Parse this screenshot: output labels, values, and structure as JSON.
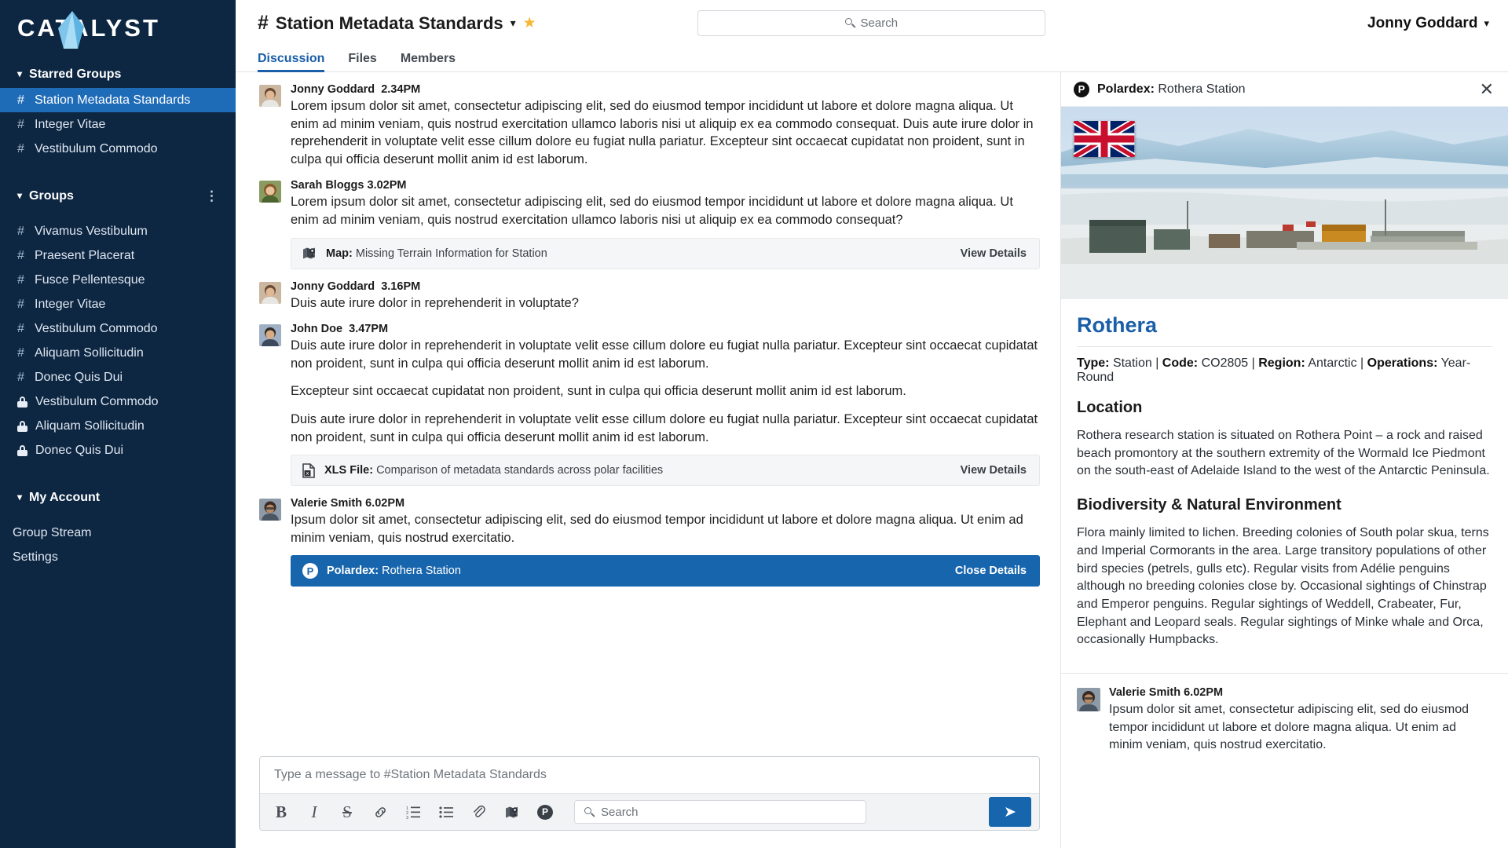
{
  "brand": {
    "name": "CATALYST",
    "accent": "#1e6bb8",
    "sidebar_bg": "#0d2642"
  },
  "sidebar": {
    "starred_section": {
      "label": "Starred Groups",
      "caret": "chevron-down-icon"
    },
    "starred_items": [
      {
        "label": "Station Metadata Standards",
        "icon": "hash",
        "active": true
      },
      {
        "label": "Integer Vitae",
        "icon": "hash",
        "active": false
      },
      {
        "label": "Vestibulum Commodo",
        "icon": "hash",
        "active": false
      }
    ],
    "groups_section": {
      "label": "Groups",
      "caret": "chevron-down-icon",
      "overflow": "kebab-menu-icon"
    },
    "group_items": [
      {
        "label": "Vivamus Vestibulum",
        "icon": "hash"
      },
      {
        "label": "Praesent Placerat",
        "icon": "hash"
      },
      {
        "label": "Fusce Pellentesque",
        "icon": "hash"
      },
      {
        "label": "Integer Vitae",
        "icon": "hash"
      },
      {
        "label": "Vestibulum Commodo",
        "icon": "hash"
      },
      {
        "label": "Aliquam Sollicitudin",
        "icon": "hash"
      },
      {
        "label": "Donec Quis Dui",
        "icon": "hash"
      },
      {
        "label": "Vestibulum Commodo",
        "icon": "lock"
      },
      {
        "label": "Aliquam Sollicitudin",
        "icon": "lock"
      },
      {
        "label": "Donec Quis Dui",
        "icon": "lock"
      }
    ],
    "account_section": {
      "label": "My Account",
      "caret": "chevron-down-icon"
    },
    "account_items": [
      {
        "label": "Group Stream"
      },
      {
        "label": "Settings"
      }
    ]
  },
  "header": {
    "hash": "#",
    "channel": "Station Metadata Standards",
    "caret": "chevron-down-icon",
    "star": "star-icon",
    "search_placeholder": "Search",
    "user": "Jonny Goddard",
    "user_caret": "chevron-down-icon"
  },
  "tabs": [
    {
      "label": "Discussion",
      "active": true
    },
    {
      "label": "Files",
      "active": false
    },
    {
      "label": "Members",
      "active": false
    }
  ],
  "messages": [
    {
      "author": "Jonny Goddard",
      "time": "2.34PM",
      "avatar": "man-1",
      "paragraphs": [
        "Lorem ipsum dolor sit amet, consectetur adipiscing elit, sed do eiusmod tempor incididunt ut labore et dolore magna aliqua. Ut enim ad minim veniam, quis nostrud exercitation ullamco laboris nisi ut aliquip ex ea commodo consequat. Duis aute irure dolor in reprehenderit in voluptate velit esse cillum dolore eu fugiat nulla pariatur. Excepteur sint occaecat cupidatat non proident, sunt in culpa qui officia deserunt mollit anim id est laborum."
      ],
      "attachment": null
    },
    {
      "author": "Sarah Bloggs",
      "time": "3.02PM",
      "avatar": "woman-1",
      "paragraphs": [
        "Lorem ipsum dolor sit amet, consectetur adipiscing elit, sed do eiusmod tempor incididunt ut labore et dolore magna aliqua. Ut enim ad minim veniam, quis nostrud exercitation ullamco laboris nisi ut aliquip ex ea commodo consequat?"
      ],
      "attachment": {
        "kind": "map-icon",
        "type_label": "Map:",
        "title": "Missing Terrain Information for Station",
        "action": "View Details",
        "style": "light"
      }
    },
    {
      "author": "Jonny Goddard",
      "time": "3.16PM",
      "avatar": "man-1",
      "paragraphs": [
        "Duis aute irure dolor in reprehenderit in voluptate?"
      ],
      "attachment": null
    },
    {
      "author": "John Doe",
      "time": "3.47PM",
      "avatar": "man-2",
      "paragraphs": [
        "Duis aute irure dolor in reprehenderit in voluptate velit esse cillum dolore eu fugiat nulla pariatur. Excepteur sint occaecat cupidatat non proident, sunt in culpa qui officia deserunt mollit anim id est laborum.",
        "Excepteur sint occaecat cupidatat non proident, sunt in culpa qui officia deserunt mollit anim id est laborum.",
        "Duis aute irure dolor in reprehenderit in voluptate velit esse cillum dolore eu fugiat nulla pariatur. Excepteur sint occaecat cupidatat non proident, sunt in culpa qui officia deserunt mollit anim id est laborum."
      ],
      "attachment": {
        "kind": "xls-file-icon",
        "type_label": "XLS File:",
        "title": "Comparison of metadata standards across polar facilities",
        "action": "View Details",
        "style": "light"
      }
    },
    {
      "author": "Valerie Smith",
      "time": "6.02PM",
      "avatar": "woman-2",
      "paragraphs": [
        "Ipsum dolor sit amet, consectetur adipiscing elit, sed do eiusmod tempor incididunt ut labore et dolore magna aliqua. Ut enim ad minim veniam, quis nostrud exercitatio."
      ],
      "attachment": {
        "kind": "polardex-icon",
        "type_label": "Polardex:",
        "title": "Rothera Station",
        "action": "Close Details",
        "style": "blue"
      }
    }
  ],
  "composer": {
    "placeholder": "Type a message to #Station Metadata Standards",
    "tools": [
      {
        "name": "bold",
        "glyph": "B"
      },
      {
        "name": "italic",
        "glyph": "I"
      },
      {
        "name": "strikethrough",
        "glyph": "S"
      },
      {
        "name": "link",
        "glyph": "🔗"
      },
      {
        "name": "ordered-list",
        "glyph": ""
      },
      {
        "name": "bulleted-list",
        "glyph": ""
      },
      {
        "name": "attachment",
        "glyph": ""
      },
      {
        "name": "map",
        "glyph": ""
      },
      {
        "name": "polardex",
        "glyph": "P"
      }
    ],
    "search_placeholder": "Search",
    "send_label": "➤"
  },
  "right_panel": {
    "header_prefix": "Polardex:",
    "header_title": "Rothera Station",
    "close": "close-icon",
    "flag": "union-jack",
    "title": "Rothera",
    "meta": [
      {
        "key": "Type:",
        "value": "Station"
      },
      {
        "key": "Code:",
        "value": "CO2805"
      },
      {
        "key": "Region:",
        "value": "Antarctic"
      },
      {
        "key": "Operations:",
        "value": "Year-Round"
      }
    ],
    "meta_text": "Type: Station | Code: CO2805 | Region: Antarctic | Operations: Year-Round",
    "sections": [
      {
        "heading": "Location",
        "body": "Rothera research station is situated on Rothera Point – a rock and raised beach promontory at the southern extremity of the Wormald Ice Piedmont on the south-east of Adelaide Island to the west of the Antarctic Peninsula."
      },
      {
        "heading": "Biodiversity & Natural Environment",
        "body": "Flora mainly limited to lichen. Breeding colonies of South polar skua, terns and Imperial Cormorants in the area. Large transitory populations of other bird species (petrels, gulls etc). Regular visits from Adélie penguins although no breeding colonies close by. Occasional sightings of Chinstrap and Emperor penguins. Regular sightings of Weddell, Crabeater, Fur, Elephant and Leopard seals. Regular sightings of Minke whale and Orca, occasionally Humpbacks."
      }
    ],
    "comment": {
      "author": "Valerie Smith 6.02PM",
      "text": "Ipsum dolor sit amet, consectetur adipiscing elit, sed do eiusmod tempor incididunt ut labore et dolore magna aliqua. Ut enim ad minim veniam, quis nostrud exercitatio."
    }
  }
}
